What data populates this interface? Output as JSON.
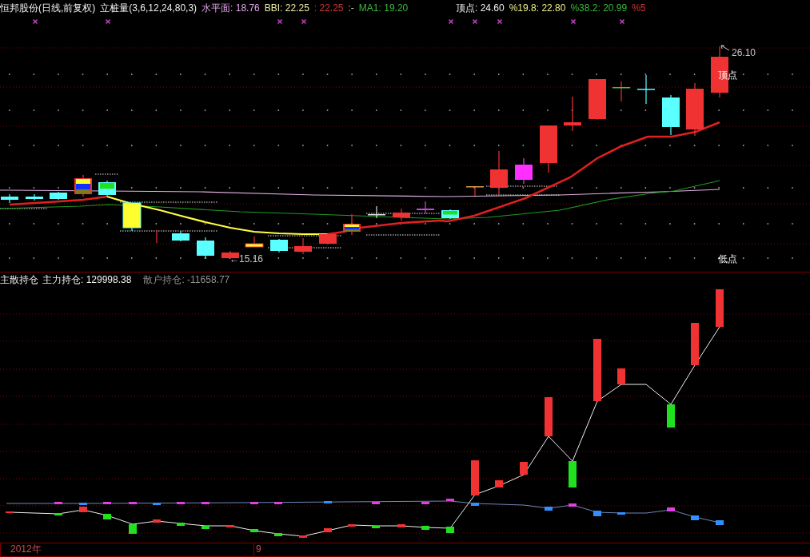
{
  "price_panel": {
    "title": "恒邦股份(日线,前复权)",
    "indicator": "立桩量(3,6,12,24,80,3)",
    "readouts": [
      {
        "text": "水平面: 18.76",
        "color": "#e6a6ee"
      },
      {
        "text": "BBI: 22.25",
        "color": "#eeeeaa"
      },
      {
        "text": ": 22.25",
        "color": "#d83232"
      },
      {
        "text": ":-"
      },
      {
        "text": "MA1: 19.20",
        "color": "#3cb83c"
      }
    ],
    "levels": [
      {
        "text": "顶点: 24.60",
        "color": "#f0f0f0"
      },
      {
        "text": "%19.8: 22.80",
        "color": "#eeee88"
      },
      {
        "text": "%38.2: 20.99",
        "color": "#3cb83c"
      },
      {
        "text": "%5",
        "color": "#d83232"
      }
    ],
    "annotations": [
      {
        "kind": "high",
        "text": "26.10"
      },
      {
        "kind": "top",
        "text": "顶点"
      },
      {
        "kind": "low",
        "text": "←15.16"
      },
      {
        "kind": "bottom",
        "text": "低点"
      }
    ]
  },
  "position_panel": {
    "title": "主散持仓",
    "readouts": [
      {
        "text": "主力持仓: 129998.38",
        "color": "#f0f0f0"
      },
      {
        "text": "散户持仓: -11658.77",
        "color": "#909090"
      }
    ]
  },
  "time_axis": [
    {
      "text": "2012年"
    },
    {
      "text": "9"
    }
  ]
}
